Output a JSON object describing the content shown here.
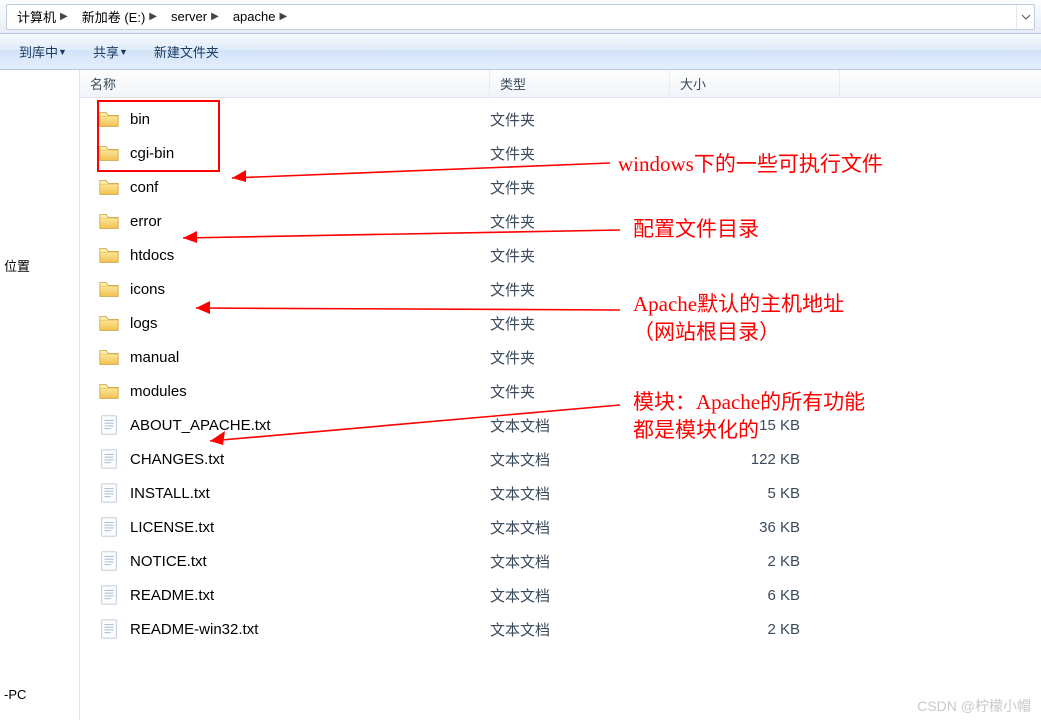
{
  "breadcrumbs": {
    "part0": "计算机",
    "part1": "新加卷 (E:)",
    "part2": "server",
    "part3": "apache"
  },
  "toolbar": {
    "include_in_library": "到库中",
    "share": "共享",
    "new_folder": "新建文件夹"
  },
  "leftnav": {
    "item_places": "位置",
    "item_pc": "-PC"
  },
  "list_headers": {
    "name": "名称",
    "type": "类型",
    "size": "大小"
  },
  "type_labels": {
    "folder": "文件夹",
    "text": "文本文档"
  },
  "rows": [
    {
      "name": "bin",
      "kind": "folder",
      "size": ""
    },
    {
      "name": "cgi-bin",
      "kind": "folder",
      "size": ""
    },
    {
      "name": "conf",
      "kind": "folder",
      "size": ""
    },
    {
      "name": "error",
      "kind": "folder",
      "size": ""
    },
    {
      "name": "htdocs",
      "kind": "folder",
      "size": ""
    },
    {
      "name": "icons",
      "kind": "folder",
      "size": ""
    },
    {
      "name": "logs",
      "kind": "folder",
      "size": ""
    },
    {
      "name": "manual",
      "kind": "folder",
      "size": ""
    },
    {
      "name": "modules",
      "kind": "folder",
      "size": ""
    },
    {
      "name": "ABOUT_APACHE.txt",
      "kind": "text",
      "size": "15 KB"
    },
    {
      "name": "CHANGES.txt",
      "kind": "text",
      "size": "122 KB"
    },
    {
      "name": "INSTALL.txt",
      "kind": "text",
      "size": "5 KB"
    },
    {
      "name": "LICENSE.txt",
      "kind": "text",
      "size": "36 KB"
    },
    {
      "name": "NOTICE.txt",
      "kind": "text",
      "size": "2 KB"
    },
    {
      "name": "README.txt",
      "kind": "text",
      "size": "6 KB"
    },
    {
      "name": "README-win32.txt",
      "kind": "text",
      "size": "2 KB"
    }
  ],
  "annotations": {
    "a1": "windows下的一些可执行文件",
    "a2": "配置文件目录",
    "a3_line1": "Apache默认的主机地址",
    "a3_line2": "（网站根目录）",
    "a4_line1": "模块：Apache的所有功能",
    "a4_line2": "都是模块化的"
  },
  "watermark": "CSDN @柠檬小帽"
}
